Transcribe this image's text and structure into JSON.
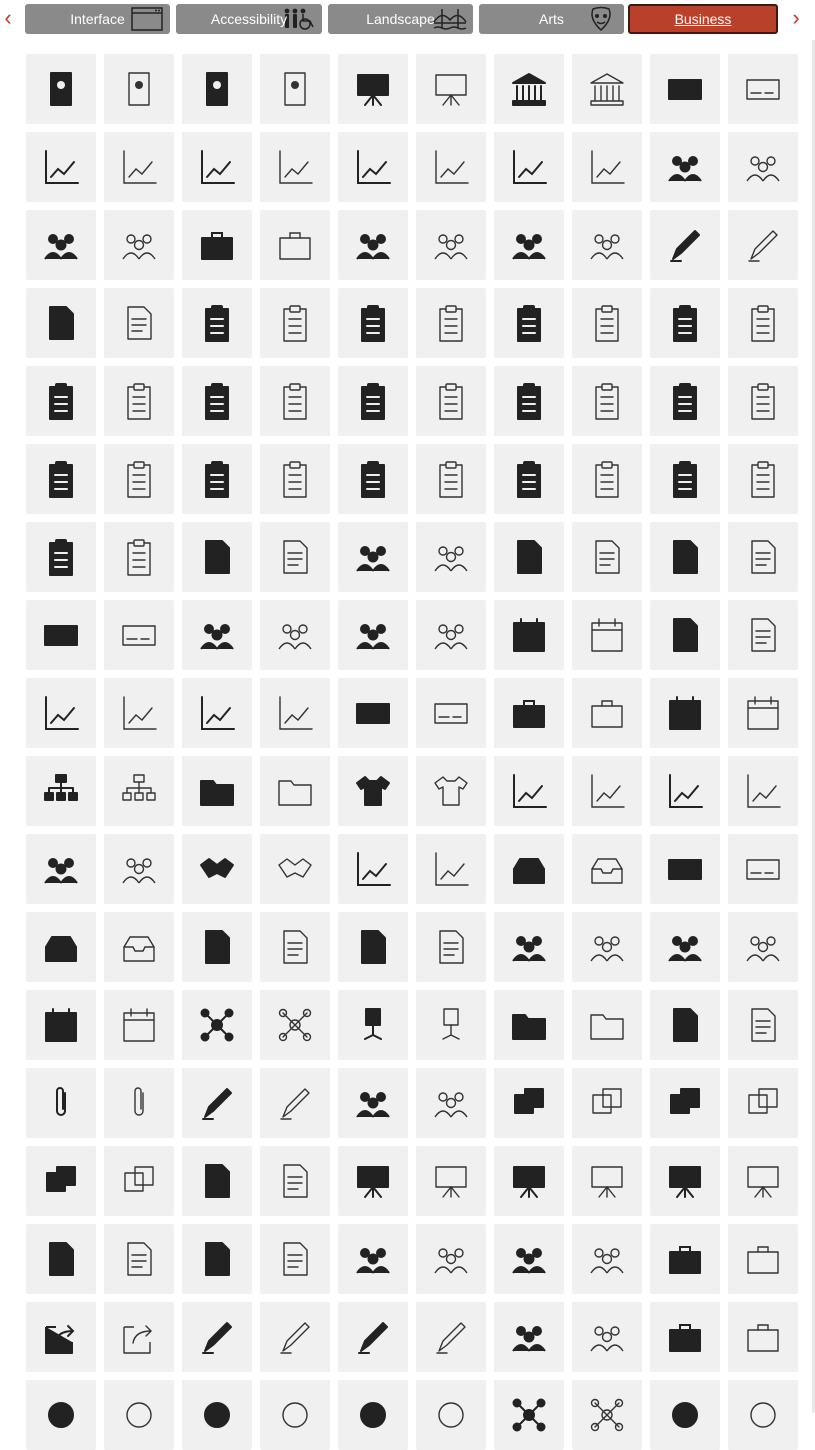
{
  "nav": {
    "prev_icon": "chevron-left-icon",
    "next_icon": "chevron-right-icon",
    "accent_color": "#b9412a"
  },
  "tabs": [
    {
      "label": "Interface",
      "icon": "window-icon",
      "active": false
    },
    {
      "label": "Accessibility",
      "icon": "people-wheelchair-icon",
      "active": false
    },
    {
      "label": "Landscape",
      "icon": "bridge-icon",
      "active": false
    },
    {
      "label": "Arts",
      "icon": "mask-icon",
      "active": false
    },
    {
      "label": "Business",
      "icon": "",
      "active": true
    }
  ],
  "icons": [
    "contact-book-icon",
    "contact-book-outline-icon",
    "address-book-icon",
    "address-book-outline-icon",
    "billboard-icon",
    "billboard-outline-icon",
    "bank-icon",
    "bank-outline-icon",
    "check-icon",
    "check-outline-icon",
    "bar-chart-down-icon",
    "bar-chart-down-outline-icon",
    "bar-chart-up-icon",
    "bar-chart-up-outline-icon",
    "growth-chart-icon",
    "growth-chart-outline-icon",
    "decline-chart-icon",
    "decline-chart-outline-icon",
    "meeting-table-icon",
    "meeting-table-outline-icon",
    "interview-icon",
    "interview-outline-icon",
    "briefcase-icon",
    "briefcase-outline-icon",
    "team-growth-icon",
    "team-growth-outline-icon",
    "team-decline-icon",
    "team-decline-outline-icon",
    "fountain-pen-icon",
    "fountain-pen-outline-icon",
    "checklist-icon",
    "checklist-outline-icon",
    "clipboard-icon",
    "clipboard-outline-icon",
    "clipboard-edit-icon",
    "clipboard-edit-outline-icon",
    "clipboard-write-icon",
    "clipboard-write-outline-icon",
    "clipboard-x-list-icon",
    "clipboard-x-list-outline-icon",
    "clipboard-x-icon",
    "clipboard-x-outline-icon",
    "clipboard-award-icon",
    "clipboard-award-outline-icon",
    "clipboard-certificate-icon",
    "clipboard-certificate-outline-icon",
    "clipboard-check-icon",
    "clipboard-check-outline-icon",
    "clipboard-tasks-icon",
    "clipboard-tasks-outline-icon",
    "clipboard-mixed-icon",
    "clipboard-mixed-outline-icon",
    "clipboard-list-icon",
    "clipboard-list-outline-icon",
    "clipboard-checklist-icon",
    "clipboard-checklist-outline-icon",
    "clipboard-done-icon",
    "clipboard-done-outline-icon",
    "clipboard-options-icon",
    "clipboard-options-outline-icon",
    "clipboard-quiz-icon",
    "clipboard-quiz-outline-icon",
    "tick-list-icon",
    "tick-list-outline-icon",
    "network-people-icon",
    "network-people-outline-icon",
    "invoice-icon",
    "invoice-outline-icon",
    "document-cancel-icon",
    "document-cancel-outline-icon",
    "credit-card-icon",
    "credit-card-outline-icon",
    "presentation-audience-icon",
    "presentation-audience-outline-icon",
    "lecture-icon",
    "lecture-outline-icon",
    "calendar-grid-icon",
    "calendar-grid-outline-icon",
    "document-icon",
    "document-outline-icon",
    "trend-down-icon",
    "trend-down-outline-icon",
    "trend-up-icon",
    "trend-up-outline-icon",
    "id-card-icon",
    "id-card-outline-icon",
    "archive-box-icon",
    "archive-box-outline-icon",
    "calendar-icon",
    "calendar-outline-icon",
    "hierarchy-icon",
    "hierarchy-outline-icon",
    "folder-icon",
    "folder-outline-icon",
    "shirt-icon",
    "shirt-outline-icon",
    "gantt-chart-icon",
    "gantt-chart-outline-icon",
    "staircase-chart-icon",
    "staircase-chart-outline-icon",
    "idea-team-icon",
    "idea-team-outline-icon",
    "handshake-icon",
    "handshake-outline-icon",
    "org-chart-icon",
    "org-chart-outline-icon",
    "inbox-download-icon",
    "inbox-download-outline-icon",
    "inbox-check-icon",
    "inbox-check-outline-icon",
    "inbox-cancel-icon",
    "inbox-cancel-outline-icon",
    "list-document-icon",
    "list-document-outline-icon",
    "list-bullets-icon",
    "list-bullets-outline-icon",
    "team-structure-icon",
    "team-structure-outline-icon",
    "conference-icon",
    "conference-outline-icon",
    "calendar-month-icon",
    "calendar-month-outline-icon",
    "network-hub-icon",
    "network-hub-outline-icon",
    "office-chair-icon",
    "office-chair-outline-icon",
    "folder-open-icon",
    "folder-open-outline-icon",
    "blank-file-icon",
    "blank-file-outline-icon",
    "paperclip-icon",
    "paperclip-outline-icon",
    "pen-icon",
    "pen-outline-icon",
    "idea-person-icon",
    "idea-person-outline-icon",
    "sticky-note-pin-icon",
    "sticky-note-pin-outline-icon",
    "sticky-notes-icon",
    "sticky-notes-outline-icon",
    "paper-stack-icon",
    "paper-stack-outline-icon",
    "presentation-checklist-icon",
    "presentation-checklist-outline-icon",
    "presentation-tasks-icon",
    "presentation-tasks-outline-icon",
    "presentation-video-icon",
    "presentation-video-outline-icon",
    "presentation-org-icon",
    "presentation-org-outline-icon",
    "refresh-list-icon",
    "refresh-list-outline-icon",
    "reorder-list-icon",
    "reorder-list-outline-icon",
    "question-person-icon",
    "question-person-outline-icon",
    "help-person-icon",
    "help-person-outline-icon",
    "cash-register-icon",
    "cash-register-outline-icon",
    "share-icon",
    "share-outline-icon",
    "signature-icon",
    "signature-outline-icon",
    "pen-signature-icon",
    "pen-signature-outline-icon",
    "network-team-icon",
    "network-team-outline-icon",
    "stapler-icon",
    "stapler-outline-icon",
    "target-icon",
    "target-outline-icon",
    "axis-icon",
    "axis-outline-icon",
    "expand-icon",
    "expand-outline-icon",
    "node-icon",
    "node-outline-icon",
    "flow-icon",
    "flow-outline-icon"
  ]
}
